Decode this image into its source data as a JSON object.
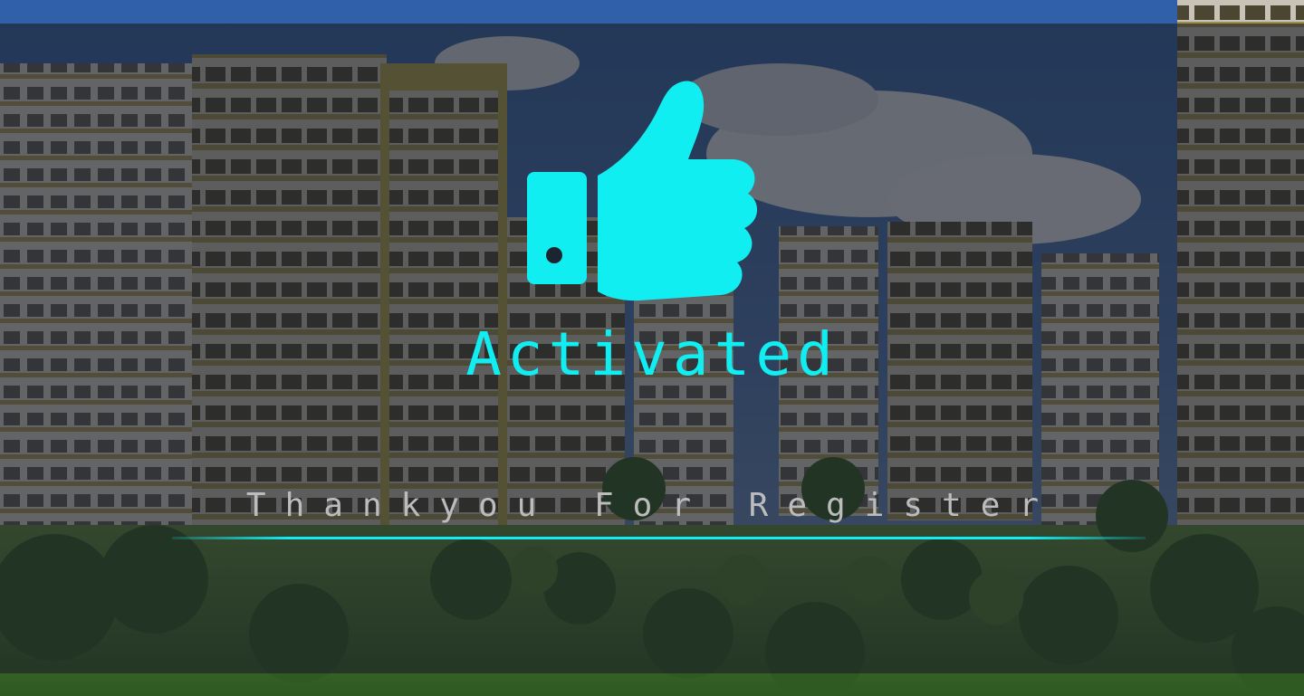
{
  "status": {
    "icon": "thumbs-up-icon",
    "title": "Activated",
    "subtitle": "Thankyou For Register"
  },
  "colors": {
    "accent": "#10eef2",
    "subtitle": "#bcbcbc",
    "overlay": "#1c1e26"
  }
}
